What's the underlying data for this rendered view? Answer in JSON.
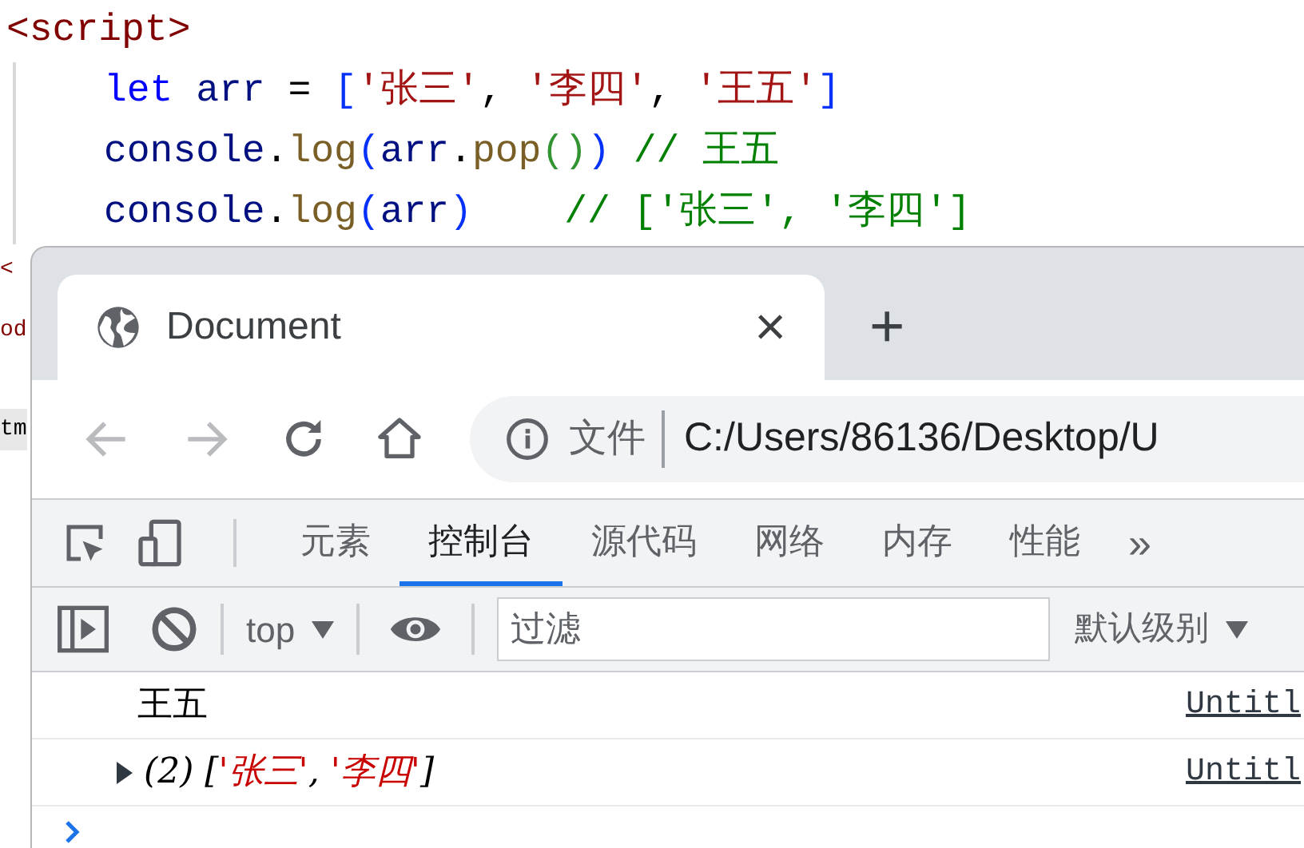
{
  "code_lines": [
    {
      "indent": false,
      "tokens": [
        {
          "text": "<script>",
          "kind": "tag"
        }
      ]
    },
    {
      "indent": true,
      "tokens": [
        {
          "text": "let",
          "kind": "keyword"
        },
        {
          "text": " arr ",
          "kind": "var"
        },
        {
          "text": "= ",
          "kind": "plain"
        },
        {
          "text": "[",
          "kind": "bracket"
        },
        {
          "text": "'张三'",
          "kind": "string"
        },
        {
          "text": ", ",
          "kind": "plain"
        },
        {
          "text": "'李四'",
          "kind": "string"
        },
        {
          "text": ", ",
          "kind": "plain"
        },
        {
          "text": "'王五'",
          "kind": "string"
        },
        {
          "text": "]",
          "kind": "bracket"
        }
      ]
    },
    {
      "indent": true,
      "tokens": [
        {
          "text": "console",
          "kind": "var"
        },
        {
          "text": ".",
          "kind": "plain"
        },
        {
          "text": "log",
          "kind": "func"
        },
        {
          "text": "(",
          "kind": "bracket"
        },
        {
          "text": "arr",
          "kind": "var"
        },
        {
          "text": ".",
          "kind": "plain"
        },
        {
          "text": "pop",
          "kind": "func"
        },
        {
          "text": "()",
          "kind": "paren2"
        },
        {
          "text": ")",
          "kind": "bracket"
        },
        {
          "text": " // 王五",
          "kind": "comment"
        }
      ]
    },
    {
      "indent": true,
      "tokens": [
        {
          "text": "console",
          "kind": "var"
        },
        {
          "text": ".",
          "kind": "plain"
        },
        {
          "text": "log",
          "kind": "func"
        },
        {
          "text": "(",
          "kind": "bracket"
        },
        {
          "text": "arr",
          "kind": "var"
        },
        {
          "text": ")",
          "kind": "bracket"
        },
        {
          "text": "    // ['张三', '李四']",
          "kind": "comment"
        }
      ]
    }
  ],
  "background_fragments": [
    {
      "text": "<",
      "kind": "tag"
    },
    {
      "text": "od",
      "kind": "tag"
    },
    {
      "text": "tm",
      "kind": "plain"
    }
  ],
  "browser": {
    "tab": {
      "title": "Document",
      "close": "×",
      "new_tab": "+"
    },
    "nav": {
      "back_enabled": false,
      "forward_enabled": false
    },
    "address": {
      "scheme_label": "文件",
      "url": "C:/Users/86136/Desktop/U"
    }
  },
  "devtools": {
    "tabs": [
      {
        "label": "元素",
        "selected": false
      },
      {
        "label": "控制台",
        "selected": true
      },
      {
        "label": "源代码",
        "selected": false
      },
      {
        "label": "网络",
        "selected": false
      },
      {
        "label": "内存",
        "selected": false
      },
      {
        "label": "性能",
        "selected": false
      }
    ],
    "more": "»",
    "console_toolbar": {
      "context": "top",
      "filter_placeholder": "过滤",
      "level": "默认级别"
    },
    "messages": [
      {
        "kind": "text",
        "tokens": [
          {
            "text": "王五",
            "kind": "plain"
          }
        ],
        "source": "Untitl"
      },
      {
        "kind": "array",
        "tokens": [
          {
            "text": "(2) [",
            "kind": "plain"
          },
          {
            "text": "'张三'",
            "kind": "consolestring"
          },
          {
            "text": ", ",
            "kind": "plain"
          },
          {
            "text": "'李四'",
            "kind": "consolestring"
          },
          {
            "text": "]",
            "kind": "plain"
          }
        ],
        "source": "Untitl"
      }
    ]
  }
}
